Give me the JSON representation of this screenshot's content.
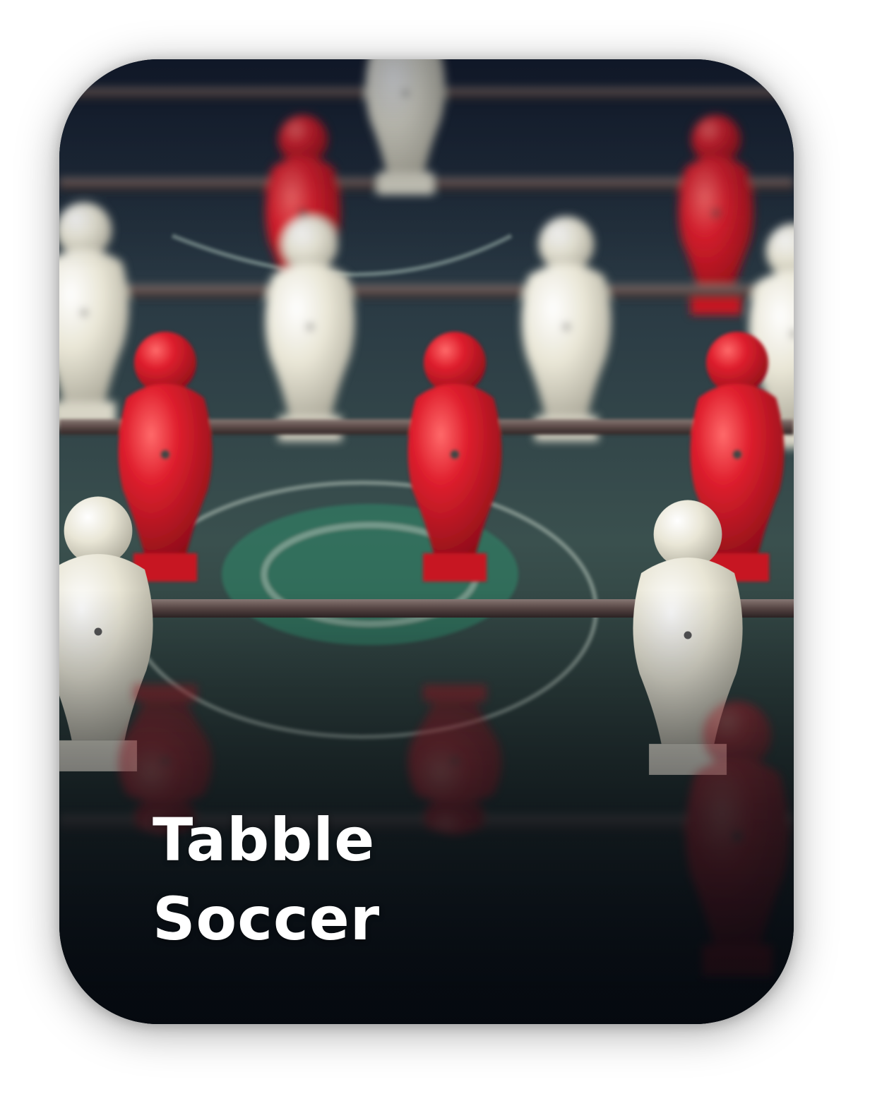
{
  "card": {
    "title_line1": "Tabble",
    "title_line2": "Soccer",
    "image_description": "table-soccer-photo",
    "colors": {
      "red_player": "#d4192b",
      "white_player": "#ece9dc",
      "field": "#2f4a47",
      "rod": "#5b4a48",
      "title_text": "#ffffff"
    }
  }
}
